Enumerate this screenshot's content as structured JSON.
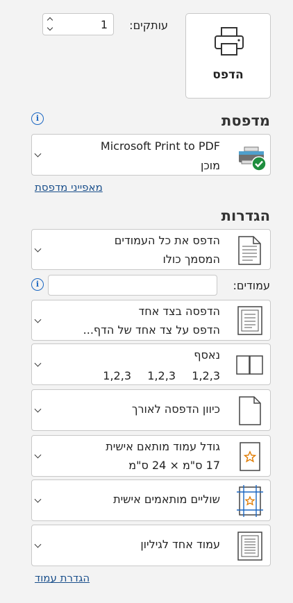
{
  "print": {
    "button_label": "הדפס"
  },
  "copies": {
    "label": "עותקים:",
    "value": "1"
  },
  "printer": {
    "section_title": "מדפסת",
    "name": "Microsoft Print to PDF",
    "status": "מוכן",
    "properties_link": "מאפייני מדפסת"
  },
  "settings": {
    "section_title": "הגדרות",
    "pages_label": "עמודים:",
    "pages_value": "",
    "items": [
      {
        "line1": "הדפס את כל העמודים",
        "line2": "המסמך כולו"
      },
      {
        "line1": "הדפסה בצד אחד",
        "line2": "הדפס על צד אחד של הדף..."
      },
      {
        "line1": "נאסף",
        "col1": "1,2,3",
        "col2": "1,2,3",
        "col3": "1,2,3"
      },
      {
        "line1": "כיוון הדפסה לאורך"
      },
      {
        "line1": "גודל עמוד מותאם אישית",
        "line2": "17 ס\"מ × 24 ס\"מ"
      },
      {
        "line1": "שוליים מותאמים אישית"
      },
      {
        "line1": "עמוד אחד לגיליון"
      }
    ],
    "page_setup_link": "הגדרת עמוד"
  },
  "colors": {
    "accent": "#1a66c2",
    "ready_green": "#1e8e3e",
    "star_orange": "#e07b00"
  }
}
